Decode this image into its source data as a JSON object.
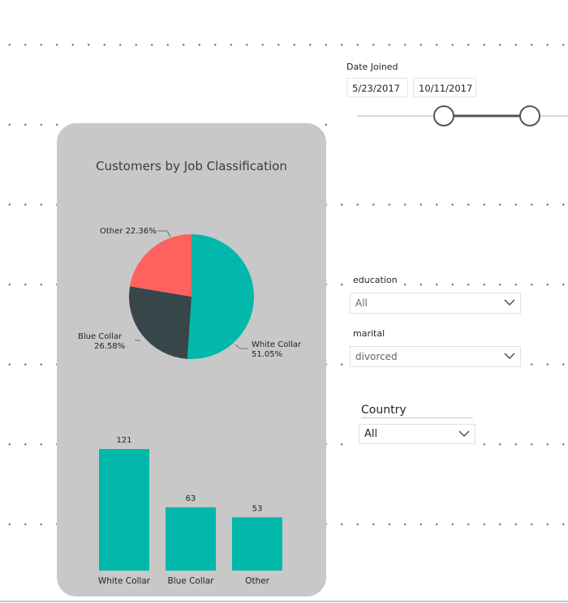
{
  "date_slicer": {
    "title": "Date Joined",
    "start": "5/23/2017",
    "end": "10/11/2017"
  },
  "chart": {
    "title": "Customers by Job Classification",
    "pie_labels": {
      "white_collar_name": "White Collar",
      "white_collar_pct": "51.05%",
      "blue_collar_name": "Blue Collar",
      "blue_collar_pct": "26.58%",
      "other": "Other 22.36%"
    }
  },
  "education": {
    "label": "education",
    "value": "All"
  },
  "marital": {
    "label": "marital",
    "value": "divorced"
  },
  "country": {
    "label": "Country",
    "value": "All"
  },
  "colors": {
    "teal": "#01b8aa",
    "dark": "#374649",
    "coral": "#fd625e"
  },
  "chart_data": [
    {
      "type": "pie",
      "title": "Customers by Job Classification",
      "categories": [
        "White Collar",
        "Blue Collar",
        "Other"
      ],
      "values": [
        51.05,
        26.58,
        22.36
      ],
      "colors": [
        "#01b8aa",
        "#374649",
        "#fd625e"
      ]
    },
    {
      "type": "bar",
      "categories": [
        "White Collar",
        "Blue Collar",
        "Other"
      ],
      "values": [
        121,
        63,
        53
      ],
      "color": "#01b8aa"
    }
  ]
}
